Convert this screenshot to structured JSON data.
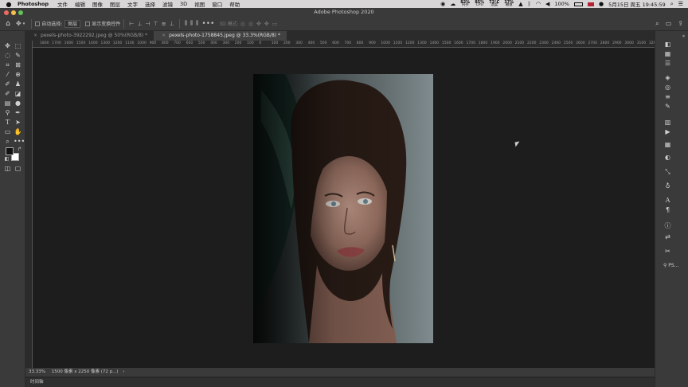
{
  "menubar": {
    "app_name": "Photoshop",
    "menus": [
      "文件",
      "编辑",
      "图像",
      "图层",
      "文字",
      "选择",
      "滤镜",
      "3D",
      "视图",
      "窗口",
      "帮助"
    ],
    "stats": [
      {
        "value": "82%",
        "label": "内存"
      },
      {
        "value": "85%",
        "label": "CPU"
      },
      {
        "value": "73°C",
        "label": "温度"
      },
      {
        "value": "37%",
        "label": "磁盘"
      }
    ],
    "battery": "100%",
    "datetime": "5月15日 周五 19:45:59"
  },
  "window": {
    "title": "Adobe Photoshop 2020",
    "traffic_colors": [
      "#ed6a5e",
      "#f5bf4f",
      "#61c554"
    ]
  },
  "options": {
    "auto_select_label": "自动选择:",
    "layer_dropdown": "图层",
    "transform_controls_label": "显示变换控件",
    "mode_3d_label": "3D 模式:"
  },
  "tabs": [
    {
      "label": "pexels-photo-3922292.jpeg @ 50%(RGB/8) *",
      "active": false
    },
    {
      "label": "pexels-photo-1758845.jpeg @ 33.3%(RGB/8) *",
      "active": true
    }
  ],
  "ruler": {
    "ticks": [
      "1800",
      "1700",
      "1600",
      "1500",
      "1400",
      "1300",
      "1200",
      "1100",
      "1000",
      "900",
      "800",
      "700",
      "600",
      "500",
      "400",
      "300",
      "200",
      "100",
      "0",
      "100",
      "200",
      "300",
      "400",
      "500",
      "600",
      "700",
      "800",
      "900",
      "1000",
      "1100",
      "1200",
      "1300",
      "1400",
      "1500",
      "1600",
      "1700",
      "1800",
      "1900",
      "2000",
      "2100",
      "2200",
      "2300",
      "2400",
      "2500",
      "2600",
      "2700",
      "2800",
      "2900",
      "3000",
      "3100",
      "3200"
    ]
  },
  "status": {
    "zoom": "33.33%",
    "doc_size": "1500 像素 x 2250 像素 (72 p...)",
    "more": "›"
  },
  "timeline": {
    "label": "时间轴"
  },
  "colors": {
    "menubar_bg": "#d8d6d7",
    "chrome_dark": "#3a3a3a",
    "canvas_bg": "#1d1d1d"
  }
}
